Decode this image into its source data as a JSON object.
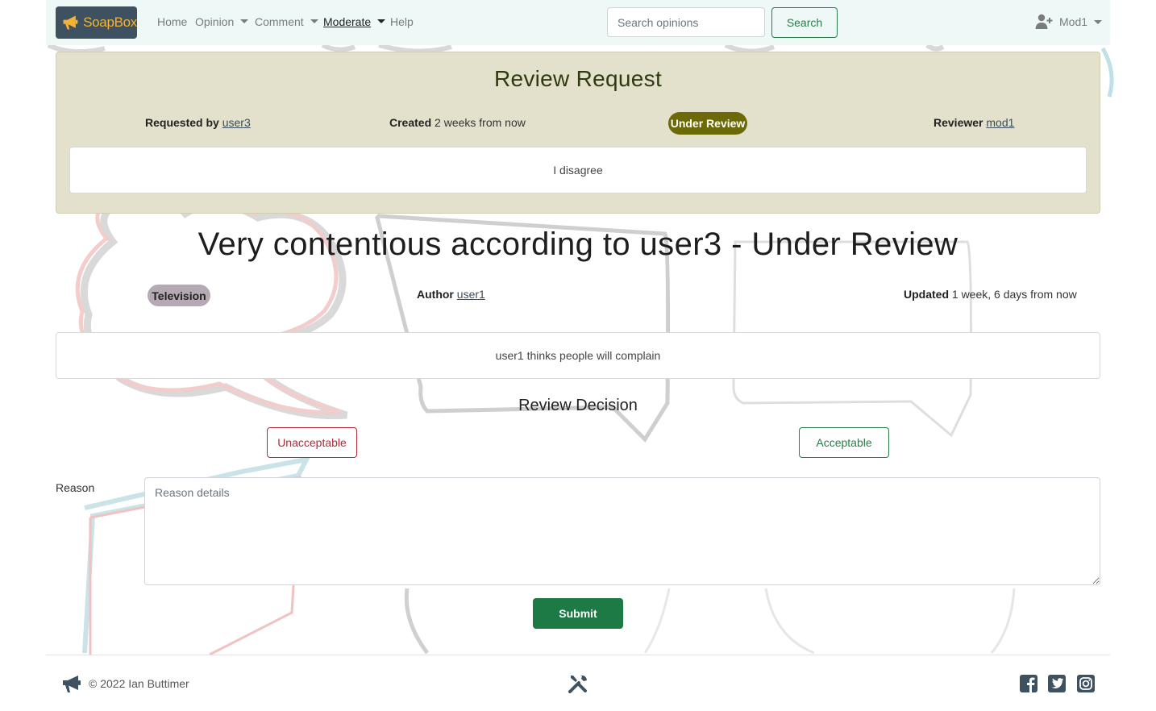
{
  "navbar": {
    "brand": "SoapBox",
    "links": [
      {
        "label": "Home"
      },
      {
        "label": "Opinion"
      },
      {
        "label": "Comment"
      },
      {
        "label": "Moderate"
      },
      {
        "label": "Help"
      }
    ],
    "search_placeholder": "Search opinions",
    "search_button": "Search",
    "user": "Mod1"
  },
  "review_request": {
    "title": "Review Request",
    "requested_by_label": "Requested by",
    "requested_by": "user3",
    "created_label": "Created",
    "created": "2 weeks from now",
    "status": "Under Review",
    "reviewer_label": "Reviewer",
    "reviewer": "mod1",
    "comment": "I disagree"
  },
  "opinion": {
    "title": "Very contentious according to user3 - Under Review",
    "category": "Television",
    "author_label": "Author",
    "author": "user1",
    "updated_label": "Updated",
    "updated": "1 week, 6 days from now",
    "content": "user1 thinks people will complain"
  },
  "decision": {
    "heading": "Review Decision",
    "unacceptable": "Unacceptable",
    "acceptable": "Acceptable",
    "reason_label": "Reason",
    "reason_placeholder": "Reason details",
    "submit": "Submit"
  },
  "footer": {
    "copyright": "© 2022 Ian Buttimer",
    "icons": [
      "megaphone-icon",
      "tools-icon",
      "facebook-icon",
      "twitter-icon",
      "instagram-icon"
    ]
  },
  "colors": {
    "navbar_bg": "#eef8f7",
    "brand_bg": "#3d5161",
    "brand_text": "#f5b234",
    "card_bg": "#e3e1cb",
    "status_badge": "#6c6a06",
    "category_badge": "#b5a9b3",
    "success": "#1e7a44",
    "danger": "#b02a37"
  }
}
